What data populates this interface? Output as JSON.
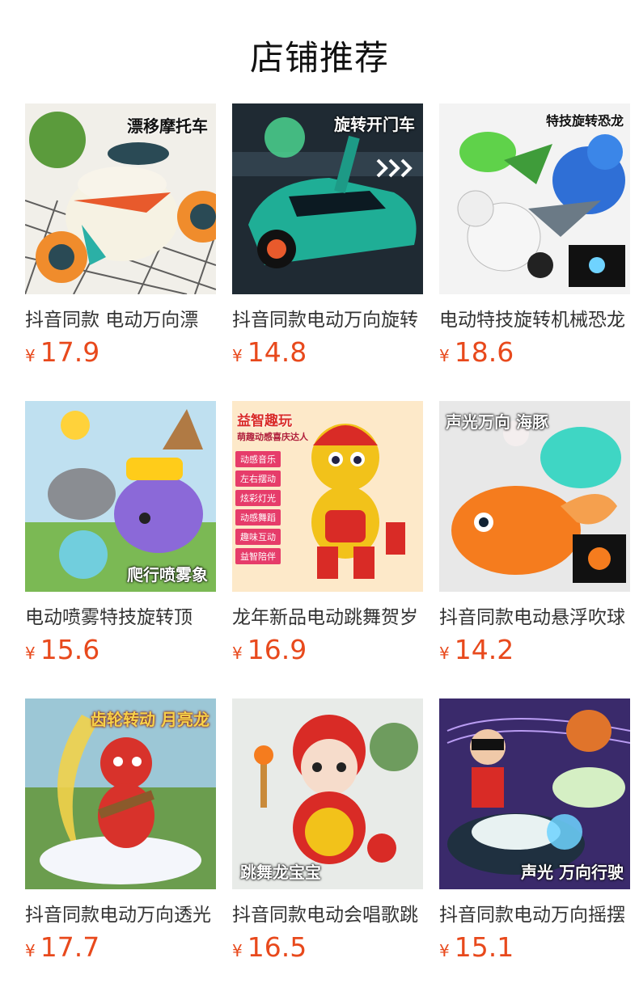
{
  "page": {
    "title": "店铺推荐"
  },
  "products": [
    {
      "name": "抖音同款 电动万向漂",
      "currency": "¥",
      "price": "17.9",
      "badge": "漂移摩托车",
      "bg": "#f1efe9",
      "accent": "#e85a2c"
    },
    {
      "name": "抖音同款电动万向旋转",
      "currency": "¥",
      "price": "14.8",
      "badge": "旋转开门车",
      "bg": "#1f2a33",
      "accent": "#1fae96"
    },
    {
      "name": "电动特技旋转机械恐龙",
      "currency": "¥",
      "price": "18.6",
      "badge": "特技旋转恐龙",
      "bg": "#f3f3f3",
      "accent": "#2f6fd6"
    },
    {
      "name": "电动喷雾特技旋转顶",
      "currency": "¥",
      "price": "15.6",
      "badge": "爬行喷雾象",
      "bg": "#bfe0f0",
      "accent": "#8b69d8"
    },
    {
      "name": "龙年新品电动跳舞贺岁",
      "currency": "¥",
      "price": "16.9",
      "badge": "益智趣玩",
      "tagline": "萌趣动感喜庆达人",
      "tags": [
        "动感音乐",
        "左右摆动",
        "炫彩灯光",
        "动感舞蹈",
        "趣味互动",
        "益智陪伴"
      ],
      "bg": "#fde9c9",
      "accent": "#f2c21a"
    },
    {
      "name": "抖音同款电动悬浮吹球",
      "currency": "¥",
      "price": "14.2",
      "badge": "声光万向 海豚",
      "bg": "#e8e8e8",
      "accent": "#f57c1e"
    },
    {
      "name": "抖音同款电动万向透光",
      "currency": "¥",
      "price": "17.7",
      "badge": "齿轮转动 月亮龙",
      "bg": "#6b9d4e",
      "accent": "#d8322b"
    },
    {
      "name": "抖音同款电动会唱歌跳",
      "currency": "¥",
      "price": "16.5",
      "badge": "跳舞龙宝宝",
      "bg": "#e8ebe8",
      "accent": "#d92b26"
    },
    {
      "name": "抖音同款电动万向摇摆",
      "currency": "¥",
      "price": "15.1",
      "badge": "声光 万向行驶",
      "bg": "#3a2a6b",
      "accent": "#2ea3c8"
    }
  ]
}
